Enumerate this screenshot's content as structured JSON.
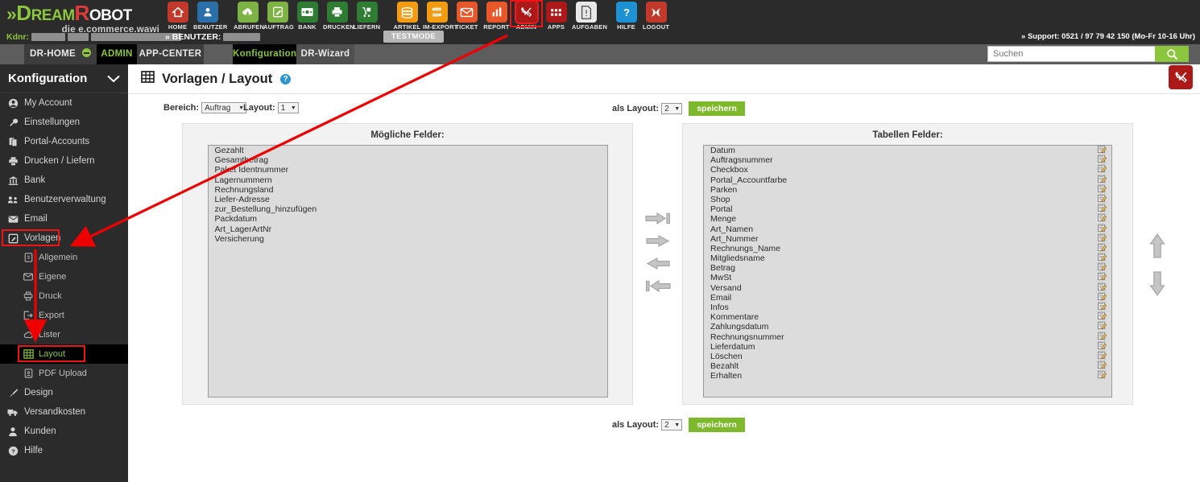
{
  "brand": {
    "name_part1": "Dream",
    "name_part2": "Robot",
    "chevron": "»",
    "tagline": "die e.commerce.wawi",
    "kdnr_label": "Kdnr:",
    "benutzer_label": "» BENUTZER:"
  },
  "header": {
    "support_text": "» Support: 0521 / 97 79 42 150 (Mo-Fr 10-16 Uhr)",
    "testmode": "TESTMODE",
    "nav": [
      {
        "label": "HOME",
        "icon": "home-icon",
        "color": "#c0392b"
      },
      {
        "label": "BENUTZER",
        "icon": "user-icon",
        "color": "#2a6fa8"
      },
      {
        "label": "ABRUFEN",
        "icon": "cloud-download-icon",
        "color": "#7cb342"
      },
      {
        "label": "AUFTRAG",
        "icon": "order-edit-icon",
        "color": "#7cb342"
      },
      {
        "label": "BANK",
        "icon": "banknote-icon",
        "color": "#2e7d32"
      },
      {
        "label": "DRUCKEN",
        "icon": "printer-icon",
        "color": "#2e7d32"
      },
      {
        "label": "LIEFERN",
        "icon": "delivery-cart-icon",
        "color": "#2e7d32"
      },
      {
        "label": "ARTIKEL",
        "icon": "articles-stack-icon",
        "color": "#f39c12"
      },
      {
        "label": "IM-EXPORT",
        "icon": "import-export-icon",
        "color": "#f39c12"
      },
      {
        "label": "TICKET",
        "icon": "envelope-icon",
        "color": "#e8572a"
      },
      {
        "label": "REPORT",
        "icon": "bar-chart-icon",
        "color": "#e8572a"
      },
      {
        "label": "ADMIN",
        "icon": "tools-icon",
        "color": "#ad1818"
      },
      {
        "label": "APPS",
        "icon": "apps-grid-icon",
        "color": "#ad1818"
      },
      {
        "label": "AUFGABEN",
        "icon": "document-icon",
        "color": "#e8e8e8"
      },
      {
        "label": "HILFE",
        "icon": "question-icon",
        "color": "#1c91d4"
      },
      {
        "label": "LOGOUT",
        "icon": "logout-x-icon",
        "color": "#c0392b"
      }
    ]
  },
  "tabs": {
    "dr_home": "DR-HOME",
    "admin": "ADMIN",
    "app_center": "APP-CENTER",
    "konfiguration": "Konfiguration",
    "dr_wizard": "DR-Wizard"
  },
  "search": {
    "placeholder": "Suchen",
    "value": "",
    "icon": "search-icon"
  },
  "sidebar": {
    "title": "Konfiguration",
    "collapse_icon": "chevron-down-icon",
    "items": [
      {
        "label": "My Account",
        "icon": "account-circle-icon",
        "level": 0
      },
      {
        "label": "Einstellungen",
        "icon": "wrench-icon",
        "level": 0
      },
      {
        "label": "Portal-Accounts",
        "icon": "copy-icon",
        "level": 0
      },
      {
        "label": "Drucken / Liefern",
        "icon": "printer-icon",
        "level": 0
      },
      {
        "label": "Bank",
        "icon": "bank-icon",
        "level": 0
      },
      {
        "label": "Benutzerverwaltung",
        "icon": "users-group-icon",
        "level": 0
      },
      {
        "label": "Email",
        "icon": "envelope-icon",
        "level": 0
      },
      {
        "label": "Vorlagen",
        "icon": "template-edit-icon",
        "level": 0,
        "boxed": true
      },
      {
        "label": "Allgemein",
        "icon": "page-icon",
        "level": 1
      },
      {
        "label": "Eigene",
        "icon": "envelope-icon",
        "level": 1
      },
      {
        "label": "Druck",
        "icon": "printer-icon",
        "level": 1
      },
      {
        "label": "Export",
        "icon": "export-icon",
        "level": 1
      },
      {
        "label": "Lister",
        "icon": "cloud-icon",
        "level": 1
      },
      {
        "label": "Layout",
        "icon": "grid-table-icon",
        "level": 1,
        "active": true,
        "boxed": true
      },
      {
        "label": "PDF Upload",
        "icon": "pdf-icon",
        "level": 1
      },
      {
        "label": "Design",
        "icon": "brush-icon",
        "level": 0
      },
      {
        "label": "Versandkosten",
        "icon": "truck-icon",
        "level": 0
      },
      {
        "label": "Kunden",
        "icon": "person-icon",
        "level": 0
      },
      {
        "label": "Hilfe",
        "icon": "question-circle-icon",
        "level": 0
      }
    ]
  },
  "page": {
    "title": "Vorlagen / Layout",
    "title_icon": "grid-table-icon",
    "help_icon": "question-help-icon",
    "help_glyph": "?",
    "tool_icon": "tools-icon"
  },
  "controls": {
    "bereich_label": "Bereich:",
    "bereich_value": "Auftrag",
    "layout_label": "Layout:",
    "layout_value": "1",
    "als_layout_label": "als Layout:",
    "als_layout_value": "2",
    "save_label": "speichern",
    "dropdown_arrow": "▼"
  },
  "panels": {
    "left_title": "Mögliche Felder:",
    "right_title": "Tabellen Felder:",
    "left_items": [
      "Gezahlt",
      "Gesamtbetrag",
      "Paket Identnummer",
      "Lagernummern",
      "Rechnungsland",
      "Liefer-Adresse",
      "zur_Bestellung_hinzufügen",
      "Packdatum",
      "Art_LagerArtNr",
      "Versicherung"
    ],
    "right_items": [
      "Datum",
      "Auftragsnummer",
      "Checkbox",
      "Portal_Accountfarbe",
      "Parken",
      "Shop",
      "Portal",
      "Menge",
      "Art_Namen",
      "Art_Nummer",
      "Rechnungs_Name",
      "Mitgliedsname",
      "Betrag",
      "MwSt",
      "Versand",
      "Email",
      "Infos",
      "Kommentare",
      "Zahlungsdatum",
      "Rechnungsnummer",
      "Lieferdatum",
      "Löschen",
      "Bezahlt",
      "Erhalten"
    ],
    "row_edit_icon": "edit-pencil-icon",
    "transfer_buttons": [
      {
        "name": "move-all-right-icon"
      },
      {
        "name": "move-right-icon"
      },
      {
        "name": "move-left-icon"
      },
      {
        "name": "move-all-left-icon"
      }
    ],
    "order_buttons": [
      {
        "name": "move-up-icon"
      },
      {
        "name": "move-down-icon"
      }
    ]
  },
  "colors": {
    "brand_green": "#8cc63e",
    "save_green": "#7db92a",
    "header_dark": "#2b2b2b",
    "annotation_red": "#f01313",
    "admin_red": "#ad1818"
  }
}
